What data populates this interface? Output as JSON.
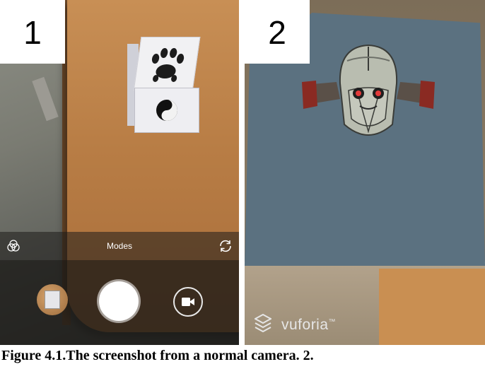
{
  "labels": {
    "panel1": "1",
    "panel2": "2"
  },
  "camera": {
    "modes_label": "Modes",
    "icons": [
      "filters-icon",
      "switch-camera-icon",
      "gallery-thumbnail",
      "shutter-button",
      "video-icon"
    ]
  },
  "ar": {
    "brand": "vuforia",
    "trademark": "™"
  },
  "caption": "Figure 4.1.The screenshot from a normal camera. 2."
}
